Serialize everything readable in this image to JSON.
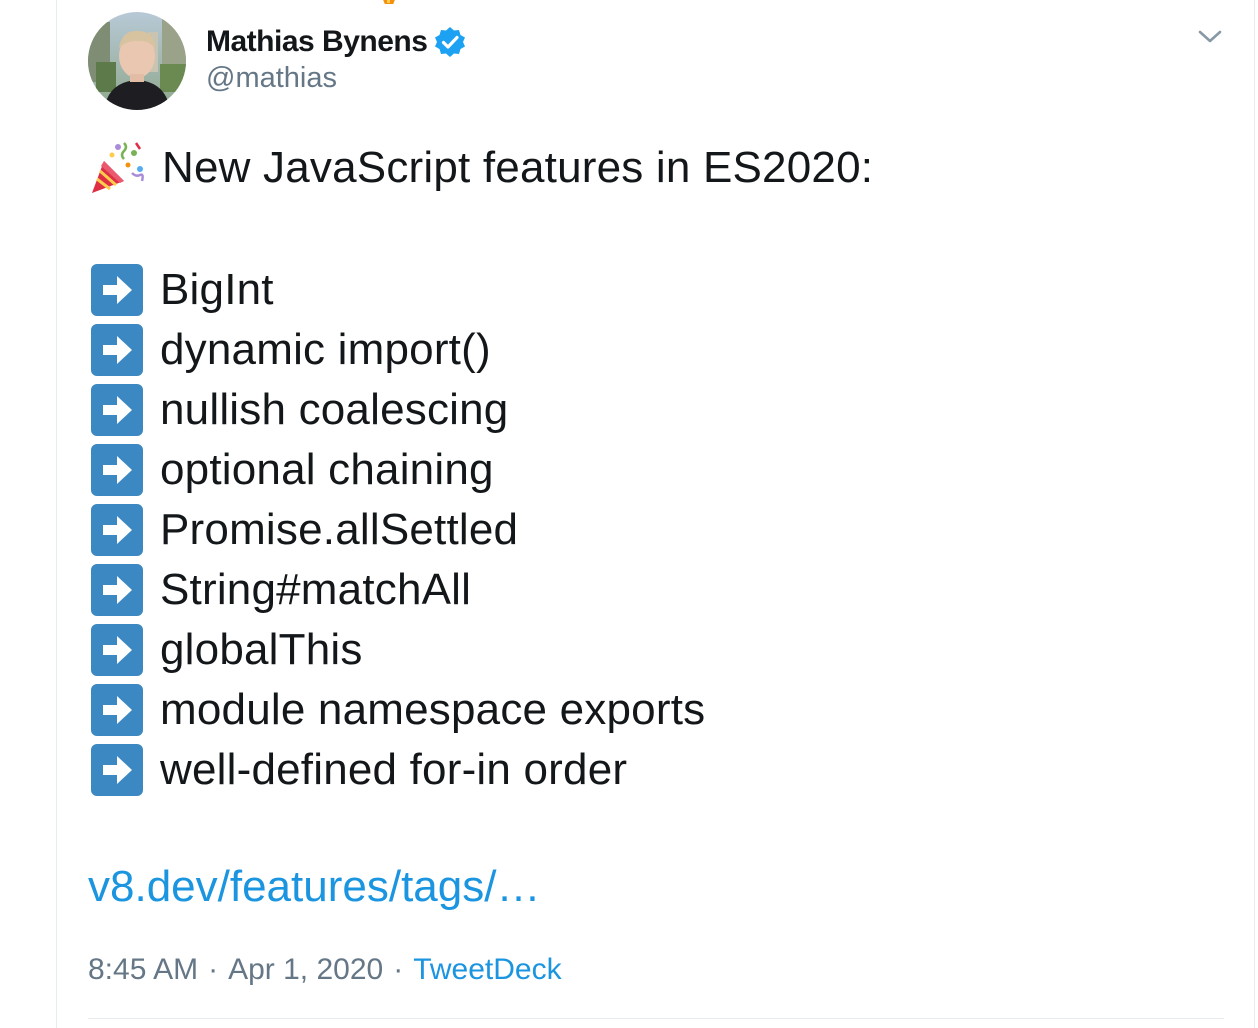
{
  "author": {
    "name": "Mathias Bynens",
    "handle": "@mathias",
    "verified": true,
    "avatar_icon": "profile-photo"
  },
  "tweet": {
    "headline_icon": "party-popper-icon",
    "headline": "New JavaScript features in ES2020:",
    "features": [
      "BigInt",
      "dynamic import()",
      "nullish coalescing",
      "optional chaining",
      "Promise.allSettled",
      "String#matchAll",
      "globalThis",
      "module namespace exports",
      "well-defined for-in order"
    ],
    "bullet_icon": "right-arrow-icon",
    "link": "v8.dev/features/tags/…"
  },
  "meta": {
    "time": "8:45 AM",
    "separator": "·",
    "date": "Apr 1, 2020",
    "source": "TweetDeck"
  },
  "colors": {
    "link": "#1b95e0",
    "secondary_text": "#657786",
    "primary_text": "#14171a",
    "verified_badge": "#1da1f2",
    "arrow_bullet": "#3b88c3"
  }
}
